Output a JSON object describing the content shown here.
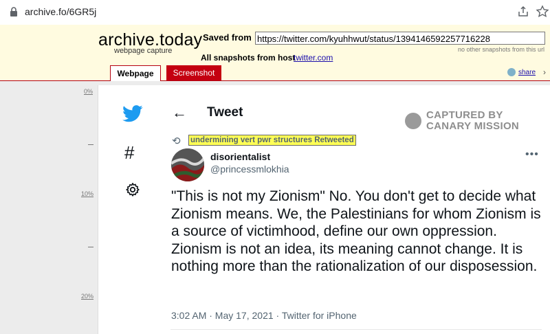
{
  "browser": {
    "url": "archive.fo/6GR5j"
  },
  "archive": {
    "title": "archive.today",
    "subtitle": "webpage capture",
    "saved_from_label": "Saved from",
    "saved_url": "https://twitter.com/kyuhhwut/status/1394146592257716228",
    "no_other_snapshots": "no other snapshots from this url",
    "all_snapshots_label": "All snapshots  from host",
    "host": "twitter.com",
    "tabs": [
      {
        "label": "Webpage",
        "active": true
      },
      {
        "label": "Screenshot",
        "active": false
      }
    ],
    "share_label": "share"
  },
  "ruler": [
    "0%",
    "10%",
    "20%"
  ],
  "tweet": {
    "header": "Tweet",
    "retweeted_by": "undermining vert pwr structures Retweeted",
    "display_name": "disorientalist",
    "handle": "@princessmlokhia",
    "text": "\"This is not my Zionism\" No. You don't get to decide what Zionism means. We, the Palestinians for whom Zionism is a source of victimhood, define our own oppression. Zionism is not an idea, its meaning cannot change. It is nothing more than the rationalization of our disposession.",
    "meta": "3:02 AM · May 17, 2021 · Twitter for iPhone"
  },
  "watermark": {
    "line1": "CAPTURED BY",
    "line2": "CANARY MISSION"
  },
  "colors": {
    "archive_bg": "#fffbe0",
    "archive_red": "#c40010",
    "twitter_blue": "#1d9bf0",
    "highlight": "#ffff55"
  }
}
